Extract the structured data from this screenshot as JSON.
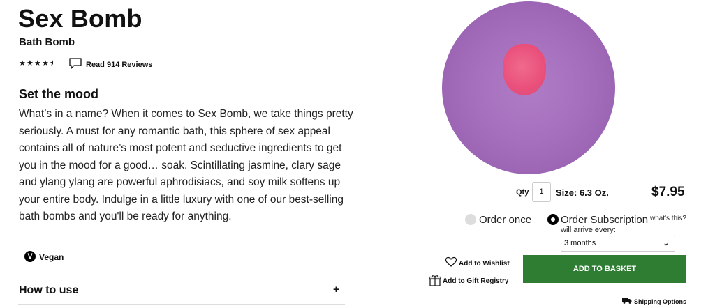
{
  "product": {
    "title": "Sex Bomb",
    "type": "Bath Bomb",
    "rating_stars": 4.5,
    "reviews_link": "Read 914 Reviews"
  },
  "description": {
    "heading": "Set the mood",
    "text": "What’s in a name? When it comes to Sex Bomb, we take things pretty seriously. A must for any romantic bath, this sphere of sex appeal contains all of nature’s most potent and seductive ingredients to get you in the mood for a good… soak. Scintillating jasmine, clary sage and ylang ylang are powerful aphrodisiacs, and soy milk softens up your entire body. Indulge in a little luxury with one of our best-selling bath bombs and you'll be ready for anything."
  },
  "badges": {
    "vegan_icon_letter": "V",
    "vegan_label": "Vegan"
  },
  "accordion": {
    "how_to_use": "How to use",
    "toggle": "+"
  },
  "purchase": {
    "qty_label": "Qty",
    "qty_value": "1",
    "size": "Size: 6.3 Oz.",
    "price": "$7.95",
    "order_once": "Order once",
    "order_subscription": "Order Subscription",
    "whats_this": "what's this?",
    "arrive_label": "will arrive every:",
    "frequency": "3 months",
    "add_to_wishlist": "Add to Wishlist",
    "add_to_registry": "Add to Gift Registry",
    "add_to_basket": "ADD TO BASKET",
    "shipping_options": "Shipping Options",
    "selected_option": "Order Subscription"
  },
  "colors": {
    "basket_button": "#2e7d32",
    "product_purple": "#a56fbd",
    "product_pink": "#e94f7a"
  },
  "icons": [
    "star-icon",
    "review-bubble-icon",
    "vegan-icon",
    "chevron-down-icon",
    "heart-icon",
    "gift-icon",
    "truck-icon"
  ]
}
